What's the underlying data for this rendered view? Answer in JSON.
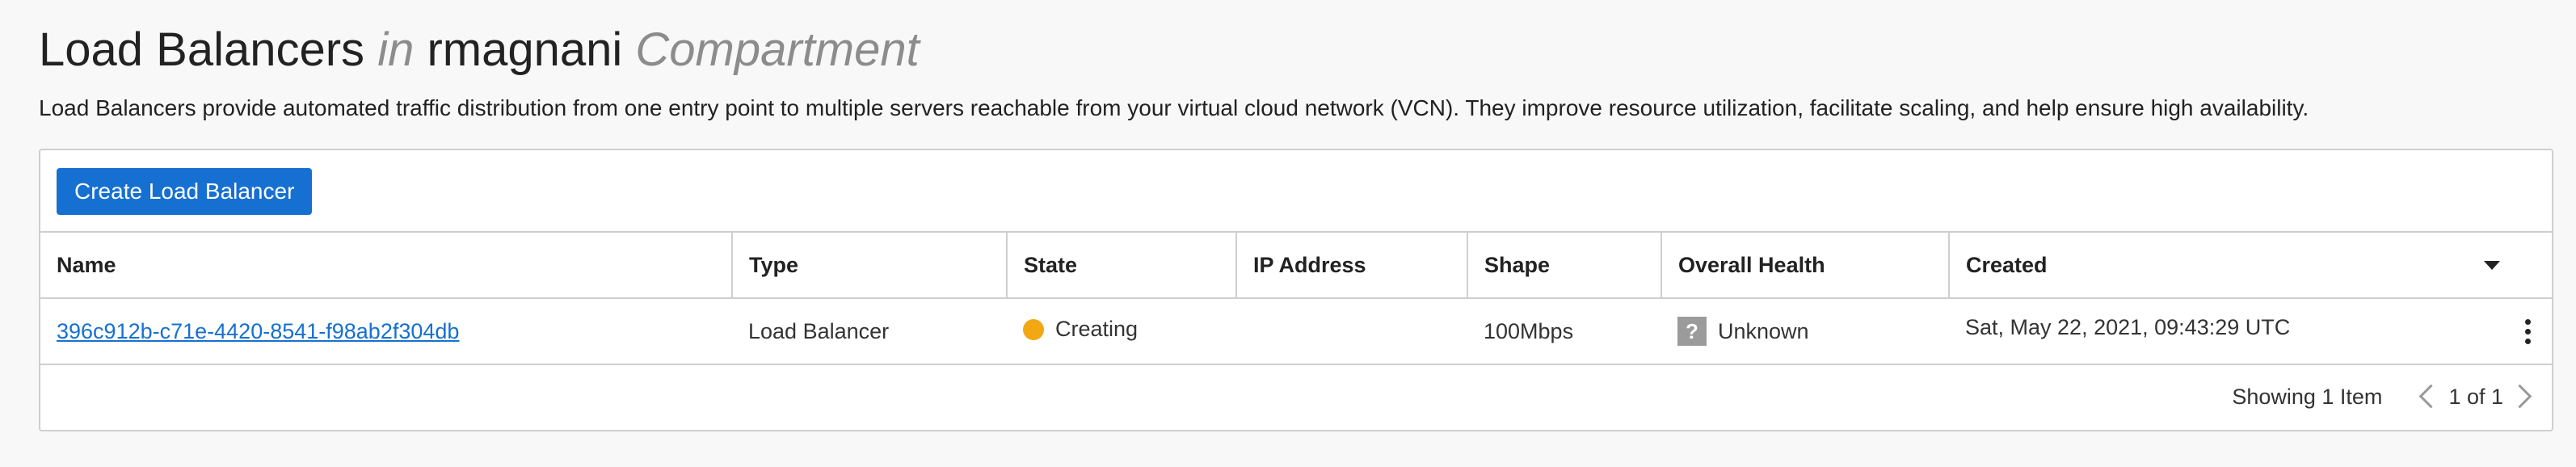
{
  "header": {
    "title_main": "Load Balancers",
    "title_in": "in",
    "compartment_name": "rmagnani",
    "title_compartment": "Compartment",
    "description": "Load Balancers provide automated traffic distribution from one entry point to multiple servers reachable from your virtual cloud network (VCN). They improve resource utilization, facilitate scaling, and help ensure high availability."
  },
  "toolbar": {
    "create_label": "Create Load Balancer"
  },
  "table": {
    "columns": [
      "Name",
      "Type",
      "State",
      "IP Address",
      "Shape",
      "Overall Health",
      "Created"
    ],
    "rows": [
      {
        "name": "396c912b-c71e-4420-8541-f98ab2f304db",
        "type": "Load Balancer",
        "state": "Creating",
        "ip_address": "",
        "shape": "100Mbps",
        "health_icon": "?",
        "overall_health": "Unknown",
        "created": "Sat, May 22, 2021, 09:43:29 UTC"
      }
    ]
  },
  "footer": {
    "showing": "Showing 1 Item",
    "page": "1 of 1"
  },
  "colors": {
    "accent": "#1670d1",
    "state_creating": "#f3a712",
    "health_unknown": "#9b9b9b"
  }
}
